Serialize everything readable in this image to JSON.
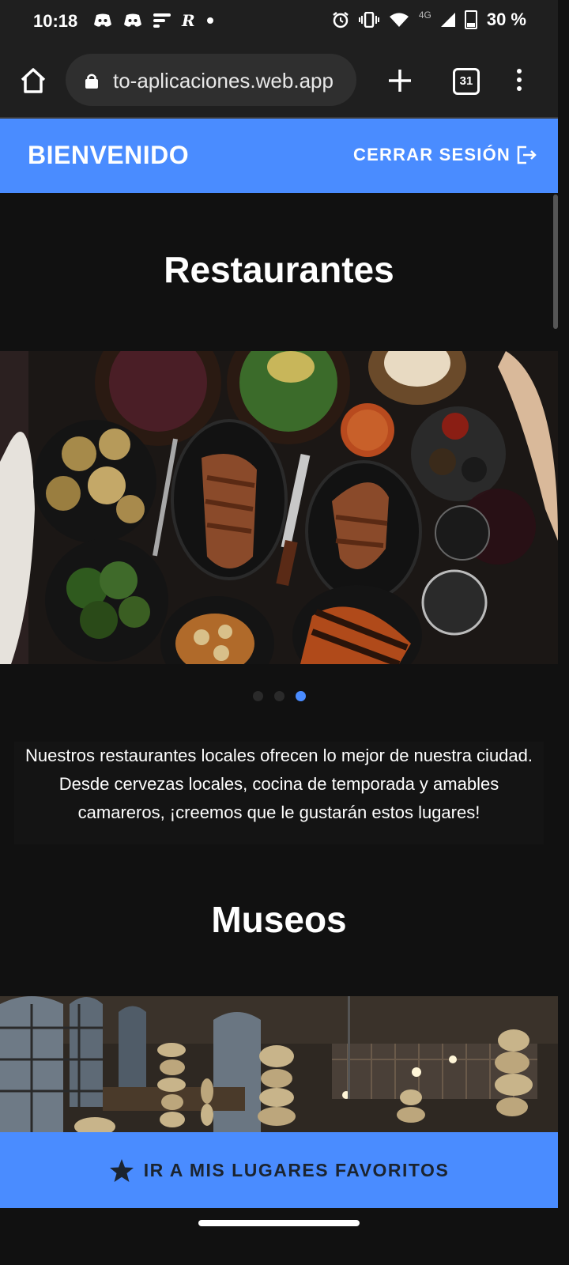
{
  "status_bar": {
    "time": "10:18",
    "notification_icons": [
      "discord-icon",
      "discord-icon",
      "feed-icon",
      "r-app-icon",
      "dot-icon"
    ],
    "notification_glyph_r": "R",
    "network": "4G",
    "battery": "30 %"
  },
  "browser": {
    "url": "to-aplicaciones.web.app",
    "tab_count": "31"
  },
  "header": {
    "title": "BIENVENIDO",
    "logout_label": "CERRAR SESIÓN"
  },
  "sections": [
    {
      "title": "Restaurantes",
      "image": "restaurant-food-photo",
      "carousel": {
        "count": 3,
        "active": 3
      },
      "description": "Nuestros restaurantes locales ofrecen lo mejor de nuestra ciudad. Desde cervezas locales, cocina de temporada y amables camareros, ¡creemos que le gustarán estos lugares!"
    },
    {
      "title": "Museos",
      "image": "museum-hall-photo"
    }
  ],
  "favorites_button": {
    "label": "IR A MIS LUGARES FAVORITOS"
  },
  "colors": {
    "accent": "#4a8cff",
    "background": "#111111",
    "toolbar": "#1f1f1f"
  }
}
